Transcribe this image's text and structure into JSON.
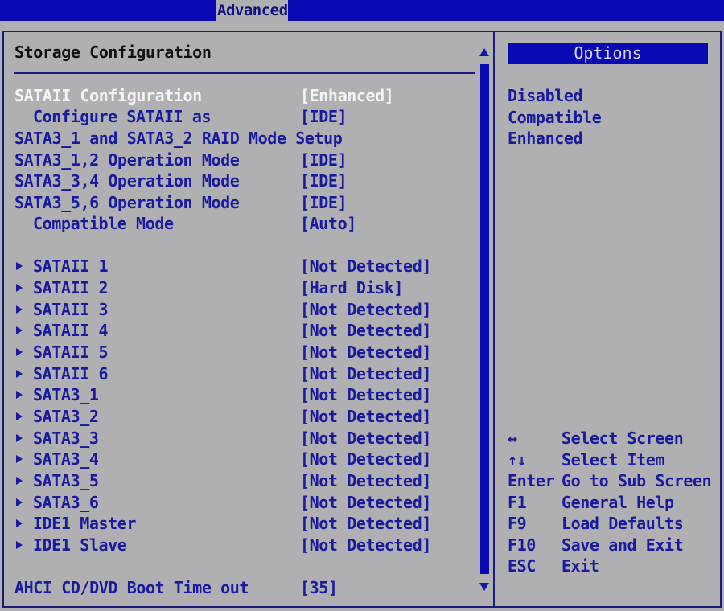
{
  "header": {
    "active_tab": "Advanced"
  },
  "main": {
    "title": "Storage Configuration",
    "rows": [
      {
        "label": "SATAII Configuration",
        "value": "[Enhanced]",
        "indent": false,
        "submenu": false,
        "selected": true
      },
      {
        "label": "Configure SATAII as",
        "value": "[IDE]",
        "indent": true,
        "submenu": false,
        "selected": false
      },
      {
        "label": "SATA3_1 and SATA3_2 RAID Mode Setup",
        "value": "",
        "indent": false,
        "submenu": false,
        "selected": false
      },
      {
        "label": "SATA3_1,2 Operation Mode",
        "value": "[IDE]",
        "indent": false,
        "submenu": false,
        "selected": false
      },
      {
        "label": "SATA3_3,4 Operation Mode",
        "value": "[IDE]",
        "indent": false,
        "submenu": false,
        "selected": false
      },
      {
        "label": "SATA3_5,6 Operation Mode",
        "value": "[IDE]",
        "indent": false,
        "submenu": false,
        "selected": false
      },
      {
        "label": "Compatible Mode",
        "value": "[Auto]",
        "indent": true,
        "submenu": false,
        "selected": false
      },
      {
        "label": "SATAII 1",
        "value": "[Not Detected]",
        "indent": true,
        "submenu": true,
        "selected": false
      },
      {
        "label": "SATAII 2",
        "value": "[Hard Disk]",
        "indent": true,
        "submenu": true,
        "selected": false
      },
      {
        "label": "SATAII 3",
        "value": "[Not Detected]",
        "indent": true,
        "submenu": true,
        "selected": false
      },
      {
        "label": "SATAII 4",
        "value": "[Not Detected]",
        "indent": true,
        "submenu": true,
        "selected": false
      },
      {
        "label": "SATAII 5",
        "value": "[Not Detected]",
        "indent": true,
        "submenu": true,
        "selected": false
      },
      {
        "label": "SATAII 6",
        "value": "[Not Detected]",
        "indent": true,
        "submenu": true,
        "selected": false
      },
      {
        "label": "SATA3_1",
        "value": "[Not Detected]",
        "indent": true,
        "submenu": true,
        "selected": false
      },
      {
        "label": "SATA3_2",
        "value": "[Not Detected]",
        "indent": true,
        "submenu": true,
        "selected": false
      },
      {
        "label": "SATA3_3",
        "value": "[Not Detected]",
        "indent": true,
        "submenu": true,
        "selected": false
      },
      {
        "label": "SATA3_4",
        "value": "[Not Detected]",
        "indent": true,
        "submenu": true,
        "selected": false
      },
      {
        "label": "SATA3_5",
        "value": "[Not Detected]",
        "indent": true,
        "submenu": true,
        "selected": false
      },
      {
        "label": "SATA3_6",
        "value": "[Not Detected]",
        "indent": true,
        "submenu": true,
        "selected": false
      },
      {
        "label": "IDE1 Master",
        "value": "[Not Detected]",
        "indent": true,
        "submenu": true,
        "selected": false
      },
      {
        "label": "IDE1 Slave",
        "value": "[Not Detected]",
        "indent": true,
        "submenu": true,
        "selected": false
      },
      {
        "label": "AHCI CD/DVD Boot Time out",
        "value": "[35]",
        "indent": false,
        "submenu": false,
        "selected": false
      }
    ]
  },
  "options": {
    "header": "Options",
    "items": [
      "Disabled",
      "Compatible",
      "Enhanced"
    ]
  },
  "help": [
    {
      "key": "↔",
      "desc": "Select Screen"
    },
    {
      "key": "↑↓",
      "desc": "Select Item"
    },
    {
      "key": "Enter",
      "desc": "Go to Sub Screen"
    },
    {
      "key": "F1",
      "desc": "General Help"
    },
    {
      "key": "F9",
      "desc": "Load Defaults"
    },
    {
      "key": "F10",
      "desc": "Save and Exit"
    },
    {
      "key": "ESC",
      "desc": "Exit"
    }
  ],
  "colors": {
    "background": "#b0afb1",
    "accent_blue": "#0a0ab4",
    "text_blue": "#1a1a9e",
    "selected_text": "#f4f4f4"
  }
}
